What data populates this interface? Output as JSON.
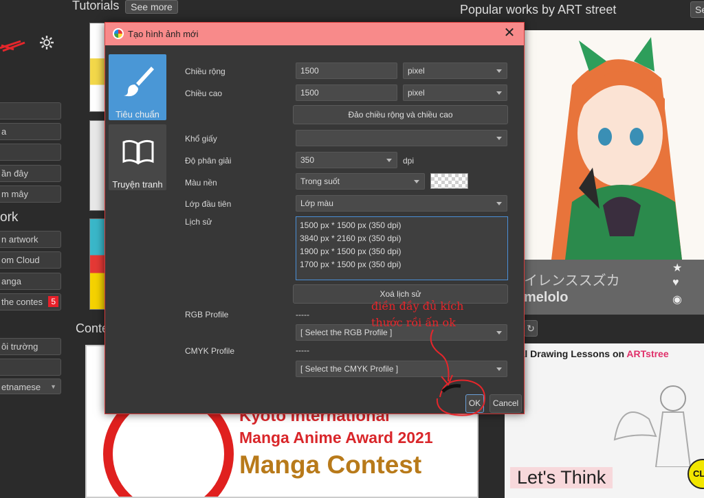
{
  "background": {
    "tutorials": {
      "title": "Tutorials",
      "see_more": "See more"
    },
    "left_menu": {
      "buttons_top": [
        "",
        "a",
        "",
        "ần đây",
        "m mây"
      ],
      "heading_work": "ork",
      "buttons_work": [
        "n artwork",
        "om Cloud",
        "anga",
        "the contes"
      ],
      "contest_badge": "5",
      "buttons_bottom": [
        "ôi trường",
        ""
      ],
      "language": "etnamese"
    },
    "contest": {
      "title": "Conte",
      "line1": "Kyoto International",
      "line2": "Manga Anime Award 2021",
      "line3": "Manga Contest"
    },
    "popular": {
      "title": "Popular works by ART street",
      "button": "Se",
      "artwork_name": "イレンススズカ",
      "artist": "melolo",
      "icons": [
        "star-icon",
        "heart-icon",
        "eye-icon"
      ]
    },
    "lesson": {
      "title": "icial Drawing Lessons on",
      "brand": "ARTstree",
      "caption": "Let's Think",
      "badge": "CL"
    }
  },
  "dialog": {
    "title": "Tạo hình ảnh mới",
    "templates": [
      {
        "label": "Tiêu chuẩn",
        "icon": "brush-icon",
        "active": true
      },
      {
        "label": "Truyện tranh",
        "icon": "book-icon",
        "active": false
      }
    ],
    "width": {
      "label": "Chiều rộng",
      "value": "1500",
      "unit": "pixel"
    },
    "height": {
      "label": "Chiều cao",
      "value": "1500",
      "unit": "pixel"
    },
    "swap_button": "Đảo chiều rộng và chiều cao",
    "paper_size": {
      "label": "Khổ giấy",
      "value": ""
    },
    "resolution": {
      "label": "Độ phân giải",
      "value": "350",
      "unit": "dpi"
    },
    "background_color": {
      "label": "Màu nền",
      "value": "Trong suốt"
    },
    "first_layer": {
      "label": "Lớp đầu tiên",
      "value": "Lớp màu"
    },
    "history": {
      "label": "Lịch sử",
      "items": [
        "1500 px * 1500 px (350 dpi)",
        "3840 px * 2160 px (350 dpi)",
        "1900 px * 1500 px (350 dpi)",
        "1700 px * 1500 px (350 dpi)"
      ],
      "clear_button": "Xoá lịch sử"
    },
    "rgb_profile": {
      "label": "RGB Profile",
      "current": "-----",
      "select": "[ Select the RGB Profile ]"
    },
    "cmyk_profile": {
      "label": "CMYK Profile",
      "current": "-----",
      "select": "[ Select the CMYK Profile ]"
    },
    "ok_button": "OK",
    "cancel_button": "Cancel"
  },
  "annotation": {
    "line1": "điền đầy đủ kích",
    "line2": "thước rồi ấn ok",
    "color": "#e5262b"
  },
  "colors": {
    "dialog_titlebar": "#f88a8a",
    "active_template": "#4a97d6",
    "dialog_bg": "#373737",
    "app_bg": "#2b2b2b"
  }
}
